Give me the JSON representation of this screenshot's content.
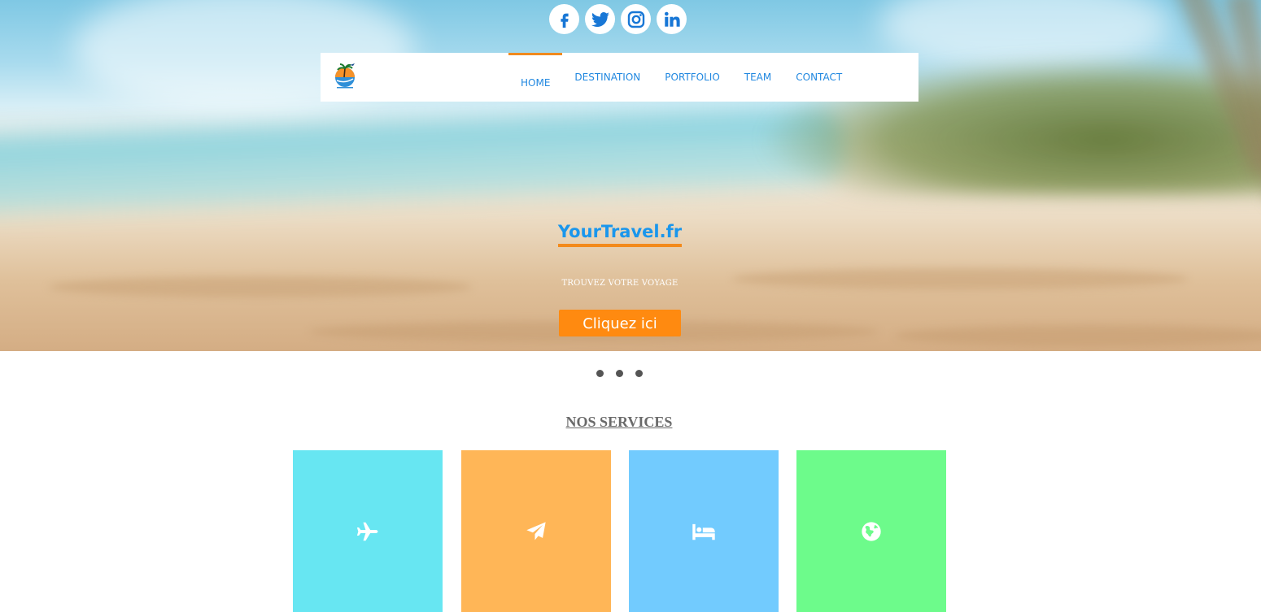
{
  "social": [
    {
      "name": "facebook-icon"
    },
    {
      "name": "twitter-icon"
    },
    {
      "name": "instagram-icon"
    },
    {
      "name": "linkedin-icon"
    }
  ],
  "header": {
    "logo": "yourtravel-logo",
    "nav": [
      {
        "label": "HOME",
        "active": true
      },
      {
        "label": "DESTINATION"
      },
      {
        "label": "PORTFOLIO"
      },
      {
        "label": "TEAM"
      },
      {
        "label": "CONTACT"
      }
    ]
  },
  "hero": {
    "title": "YourTravel.fr",
    "subtitle": "TROUVEZ VOTRE VOYAGE",
    "cta_label": "Cliquez ici"
  },
  "carousel": {
    "slides": 3
  },
  "services": {
    "title": "NOS SERVICES",
    "tiles": [
      {
        "icon": "plane-icon",
        "color": "#67e6f2"
      },
      {
        "icon": "paper-plane-icon",
        "color": "#ffb657"
      },
      {
        "icon": "bed-icon",
        "color": "#72cbfe"
      },
      {
        "icon": "globe-icon",
        "color": "#6dfb8b"
      }
    ]
  },
  "colors": {
    "accent_orange": "#ff8a10",
    "underline_orange": "#f38a1b",
    "brand_blue": "#1a96ec",
    "nav_blue": "#2188e0",
    "social_blue": "#1877d6"
  }
}
